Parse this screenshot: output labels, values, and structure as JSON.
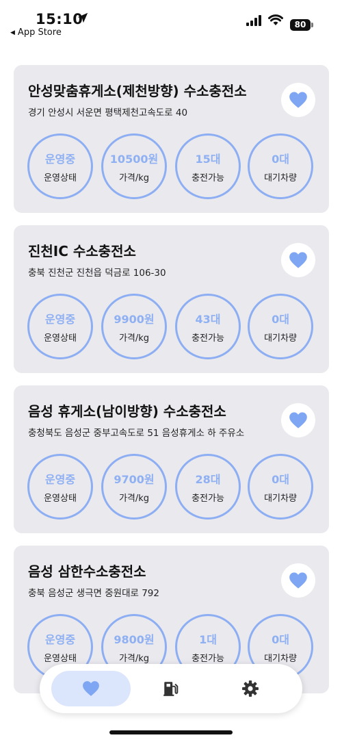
{
  "status_bar": {
    "time": "15:10",
    "back_app": "App Store",
    "battery": "80"
  },
  "colors": {
    "accent": "#7fa6f3",
    "card_bg": "#e9e9ee",
    "ring": "#8daef2"
  },
  "stations": [
    {
      "title": "안성맞춤휴게소(제천방향) 수소충전소",
      "address": "경기 안성시 서운면 평택제천고속도로 40",
      "status": "운영중",
      "status_label": "운영상태",
      "price": "10500원",
      "price_label": "가격/kg",
      "available": "15대",
      "available_label": "충전가능",
      "waiting": "0대",
      "waiting_label": "대기차량"
    },
    {
      "title": "진천IC 수소충전소",
      "address": "충북 진천군 진천읍 덕금로 106-30",
      "status": "운영중",
      "status_label": "운영상태",
      "price": "9900원",
      "price_label": "가격/kg",
      "available": "43대",
      "available_label": "충전가능",
      "waiting": "0대",
      "waiting_label": "대기차량"
    },
    {
      "title": "음성 휴게소(남이방향) 수소충전소",
      "address": "충청북도 음성군 중부고속도로 51 음성휴게소 하 주유소",
      "status": "운영중",
      "status_label": "운영상태",
      "price": "9700원",
      "price_label": "가격/kg",
      "available": "28대",
      "available_label": "충전가능",
      "waiting": "0대",
      "waiting_label": "대기차량"
    },
    {
      "title": "음성 삼한수소충전소",
      "address": "충북 음성군 생극면 중원대로 792",
      "status": "운영중",
      "status_label": "운영상태",
      "price": "9800원",
      "price_label": "가격/kg",
      "available": "1대",
      "available_label": "충전가능",
      "waiting": "0대",
      "waiting_label": "대기차량"
    }
  ],
  "tab_bar": {
    "tabs": [
      {
        "icon": "heart-icon",
        "active": true
      },
      {
        "icon": "fuel-pump-icon",
        "active": false
      },
      {
        "icon": "gear-icon",
        "active": false
      }
    ]
  }
}
